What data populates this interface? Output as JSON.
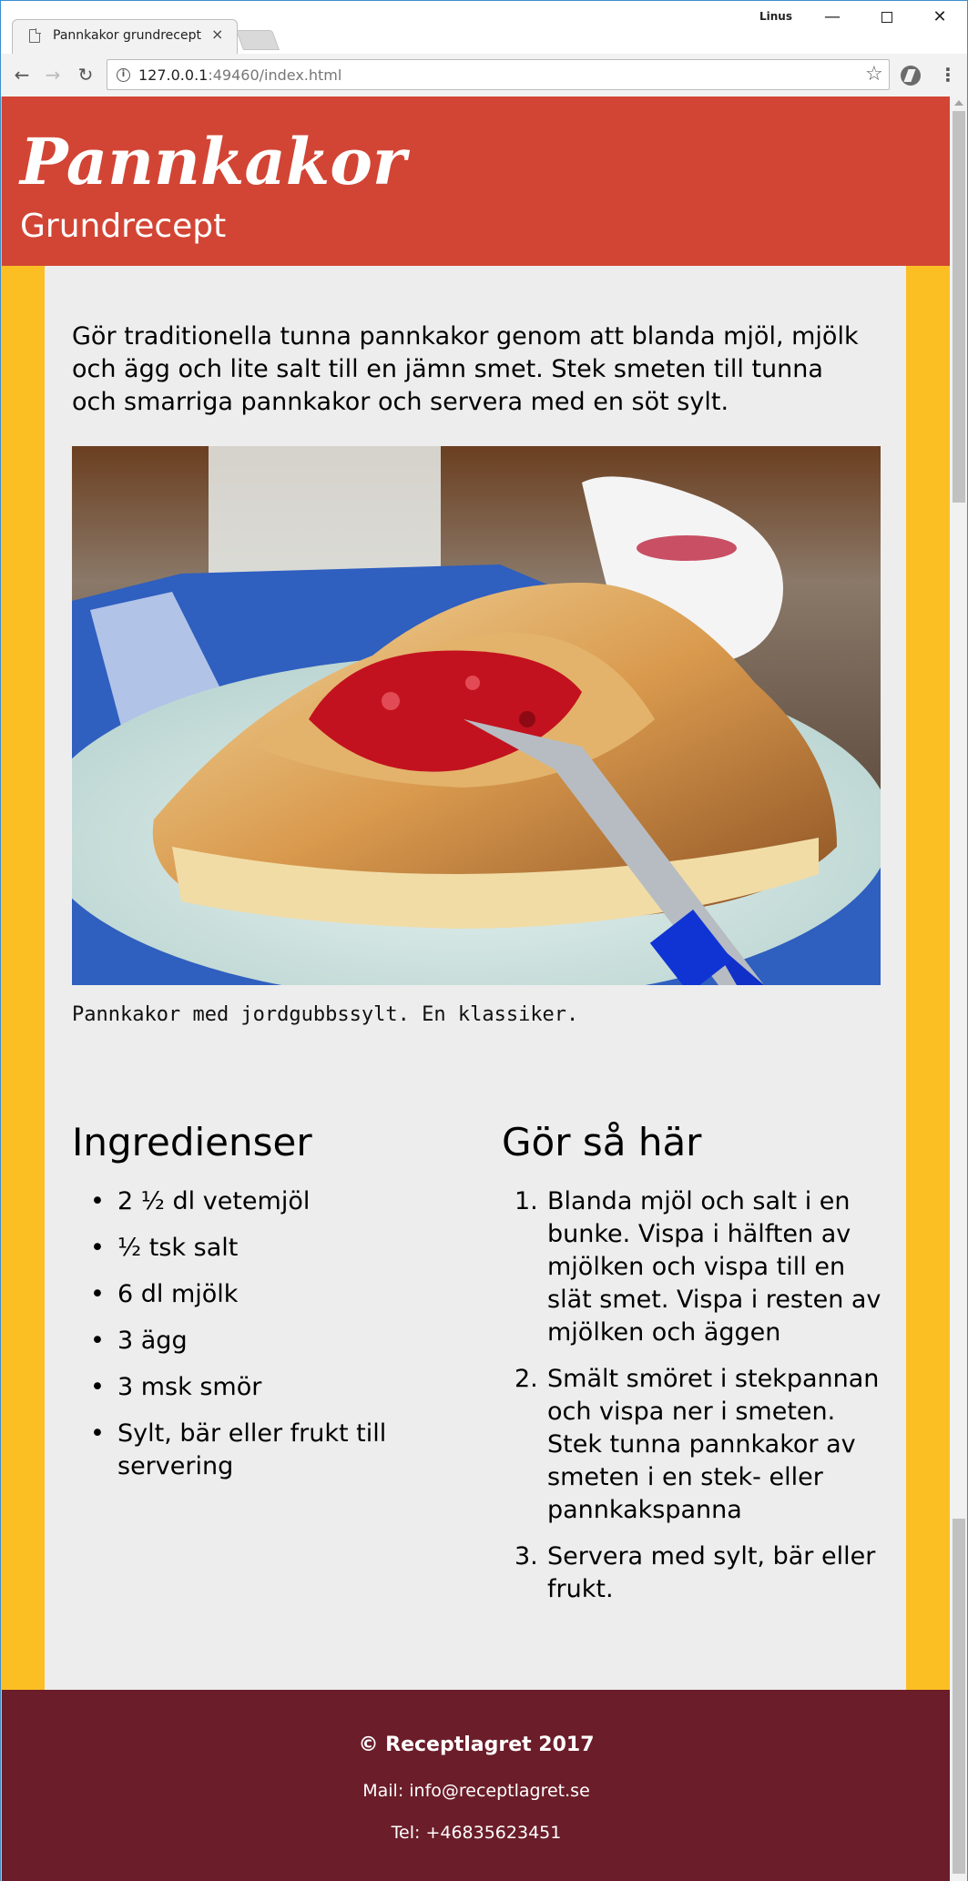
{
  "browser": {
    "tab_title": "Pannkakor grundrecept",
    "tab_close": "×",
    "user": "Linus",
    "url_host": "127.0.0.1",
    "url_rest": ":49460/index.html",
    "win_min": "—",
    "win_close": "✕",
    "nav_back": "←",
    "nav_forward": "→",
    "nav_reload": "↻",
    "star": "☆",
    "menu": "⋮",
    "info": "i"
  },
  "header": {
    "title": "Pannkakor",
    "subtitle": "Grundrecept",
    "bg_color": "#d24535"
  },
  "intro": "Gör traditionella tunna pannkakor genom att blanda mjöl, mjölk och ägg och lite salt till en jämn smet. Stek smeten till tunna och smarriga pannkakor och servera med en söt sylt.",
  "photo": {
    "caption": "Pannkakor med jordgubbssylt. En klassiker."
  },
  "ingredients": {
    "heading": "Ingredienser",
    "items": [
      "2 ½ dl vetemjöl",
      "½ tsk salt",
      "6 dl mjölk",
      "3 ägg",
      "3 msk smör",
      "Sylt, bär eller frukt till servering"
    ]
  },
  "steps": {
    "heading": "Gör så här",
    "items": [
      {
        "num": "1.",
        "text": "Blanda mjöl och salt i en bunke. Vispa i hälften av mjölken och vispa till en slät smet. Vispa i resten av mjölken och äggen"
      },
      {
        "num": "2.",
        "text": "Smält smöret i stekpannan och vispa ner i smeten. Stek tunna pannkakor av smeten i en stek- eller pannkakspanna"
      },
      {
        "num": "3.",
        "text": "Servera med sylt, bär eller frukt."
      }
    ]
  },
  "footer": {
    "copyright": "© Receptlagret 2017",
    "mail": "Mail: info@receptlagret.se",
    "tel": "Tel: +46835623451",
    "bg_color": "#6b1d29"
  },
  "colors": {
    "side_bg": "#fbbf24",
    "content_bg": "#ededed"
  }
}
